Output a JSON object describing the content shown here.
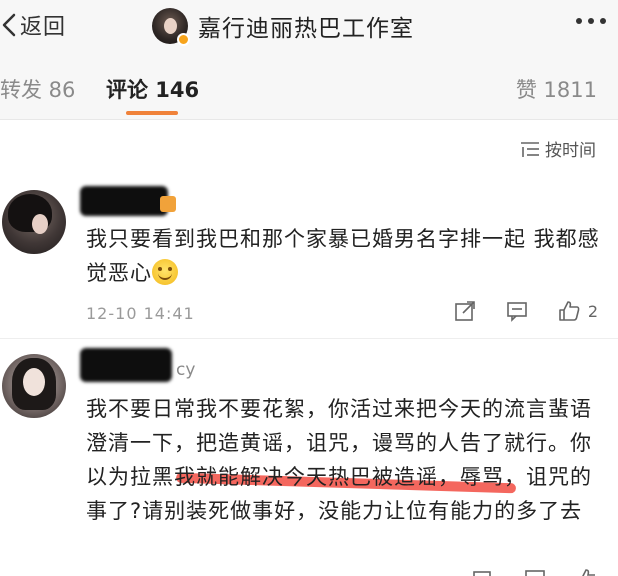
{
  "header": {
    "back_label": "返回",
    "title": "嘉行迪丽热巴工作室"
  },
  "tabs": {
    "forward": "转发 86",
    "comments": "评论 146",
    "likes": "赞 1811"
  },
  "sort": {
    "label": "按时间"
  },
  "comments": [
    {
      "text": "我只要看到我巴和那个家暴已婚男名字排一起 我都感觉恶心",
      "time": "12-10 14:41",
      "likes": "2"
    },
    {
      "name_visible": "cy",
      "text": "我不要日常我不要花絮，你活过来把今天的流言蜚语澄清一下，把造黄谣，诅咒，谩骂的人告了就行。你以为拉黑我就能解决今天热巴被造谣，辱骂，诅咒的事了?请别装死做事好，没能力让位有能力的多了去"
    }
  ],
  "colors": {
    "accent": "#f0823a",
    "highlight": "#f2463a"
  }
}
